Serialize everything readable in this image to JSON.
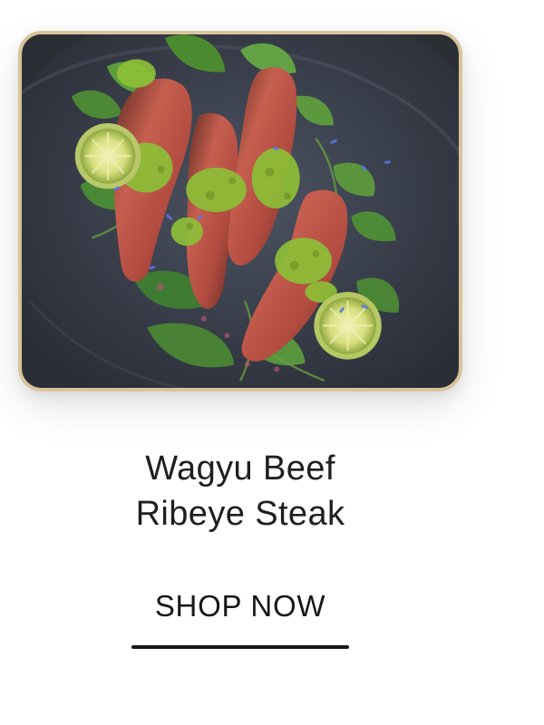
{
  "product": {
    "title_line1": "Wagyu Beef",
    "title_line2": "Ribeye Steak",
    "image_description": "sliced steak with chimichurri and lime on a dark plate"
  },
  "cta": {
    "label": "SHOP NOW"
  },
  "colors": {
    "card_border": "#d8c49b",
    "plate": "#2f3138",
    "text": "#1f1f1f",
    "underline": "#171717"
  }
}
